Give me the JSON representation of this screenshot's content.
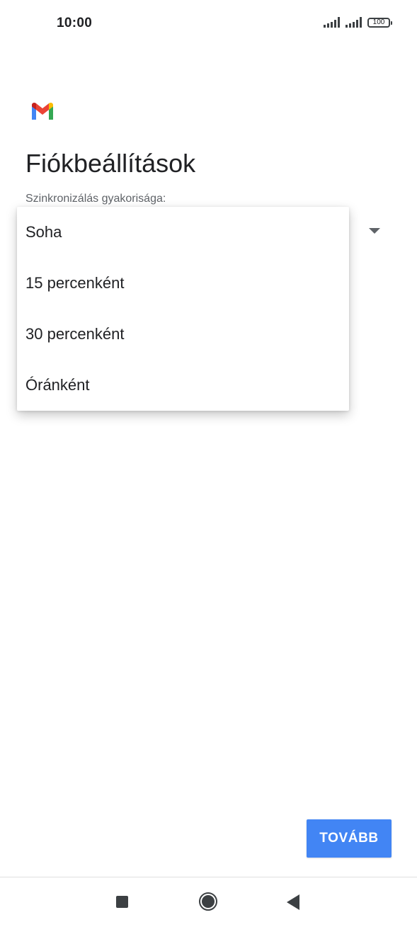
{
  "status_bar": {
    "time": "10:00",
    "battery_level": "100",
    "icons": [
      "signal-icon",
      "signal-icon",
      "battery-icon"
    ]
  },
  "app": {
    "logo_icon": "gmail-logo-icon",
    "logo_colors": [
      "#4285f4",
      "#ea4335",
      "#fbbc04",
      "#34a853",
      "#c5221f"
    ]
  },
  "page": {
    "title": "Fiókbeállítások"
  },
  "sync_frequency": {
    "label": "Szinkronizálás gyakorisága:",
    "dropdown_icon": "dropdown-arrow-icon",
    "options": [
      "Soha",
      "15 percenként",
      "30 percenként",
      "Óránként"
    ]
  },
  "actions": {
    "next_label": "TOVÁBB",
    "next_color": "#4285f4"
  },
  "nav_bar": {
    "icons": [
      "recents-icon",
      "home-icon",
      "back-icon"
    ]
  }
}
